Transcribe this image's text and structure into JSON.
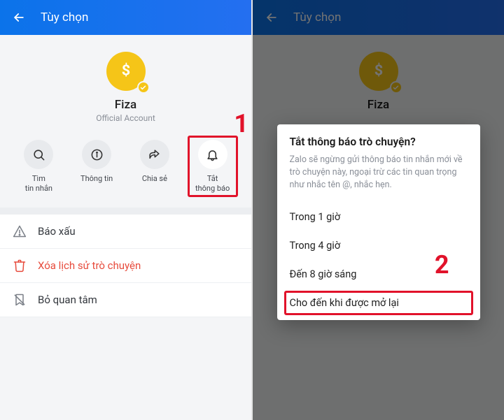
{
  "left": {
    "header": {
      "title": "Tùy chọn"
    },
    "profile": {
      "name": "Fiza",
      "subtitle": "Official Account"
    },
    "actions": {
      "search": "Tìm\ntin nhắn",
      "info": "Thông tin",
      "share": "Chia sẻ",
      "mute": "Tắt\nthông báo"
    },
    "list": {
      "report": "Báo xấu",
      "clear_history": "Xóa lịch sử trò chuyện",
      "unfollow": "Bỏ quan tâm"
    },
    "callout": "1"
  },
  "right": {
    "header": {
      "title": "Tùy chọn"
    },
    "profile": {
      "name": "Fiza"
    },
    "dialog": {
      "title": "Tắt thông báo trò chuyện?",
      "desc": "Zalo sẽ ngừng gửi thông báo tin nhắn mới về trò chuyện này, ngoại trừ các tin quan trọng như nhắc tên @, nhắc hẹn.",
      "opt1": "Trong 1 giờ",
      "opt2": "Trong 4 giờ",
      "opt3": "Đến 8 giờ sáng",
      "opt4": "Cho đến khi được mở lại"
    },
    "callout": "2"
  }
}
